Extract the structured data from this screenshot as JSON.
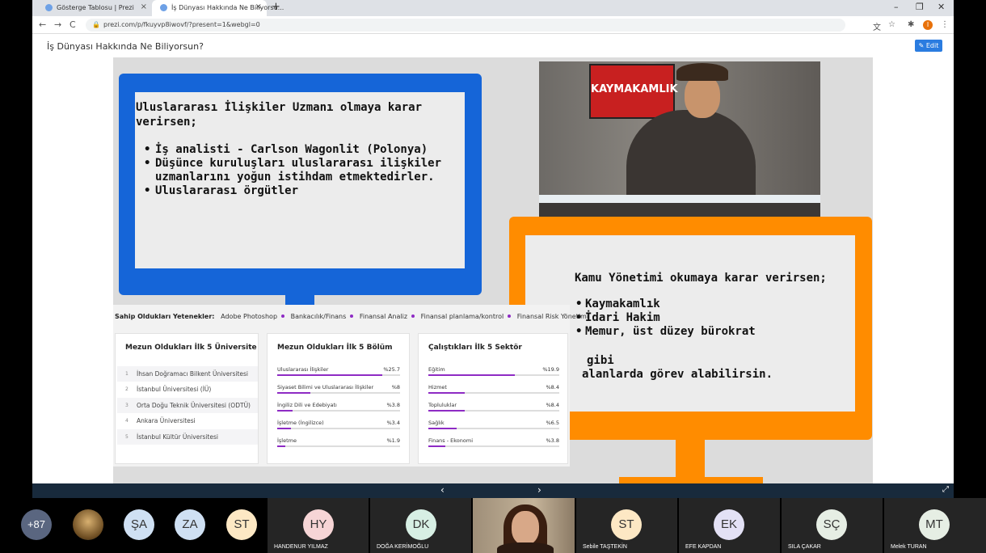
{
  "browser": {
    "tabs": [
      {
        "title": "Gösterge Tablosu | Prezi"
      },
      {
        "title": "İş Dünyası Hakkında Ne Biliyorsu..."
      }
    ],
    "new_tab": "+",
    "window_controls": {
      "minimize": "–",
      "restore": "❐",
      "close": "✕"
    },
    "nav": {
      "back": "←",
      "forward": "→",
      "reload": "C"
    },
    "url": "prezi.com/p/fkuyvp8iwovf/?present=1&webgl=0",
    "profile_initial": "I"
  },
  "prezi": {
    "title": "İş Dünyası Hakkında Ne Biliyorsun?",
    "edit_label": "Edit"
  },
  "slide": {
    "blue": {
      "heading": "Uluslararası İlişkiler Uzmanı olmaya karar verirsen;",
      "items": [
        "İş analisti - Carlson Wagonlit (Polonya)",
        "Düşünce kuruluşları uluslararası ilişkiler uzmanlarını yoğun istihdam etmektedirler.",
        "Uluslararası örgütler"
      ]
    },
    "photo_sign": "KAYMAKAMLIK",
    "orange": {
      "heading": "Kamu Yönetimi okumaya karar verirsen;",
      "items": [
        "Kaymakamlık",
        "İdari Hakim",
        "Memur, üst düzey bürokrat"
      ],
      "gibi": "gibi",
      "tail": "alanlarda görev alabilirsin."
    },
    "skills": {
      "label": "Sahip Oldukları Yetenekler:",
      "items": [
        "Adobe Photoshop",
        "Bankacılık/Finans",
        "Finansal Analiz",
        "Finansal planlama/kontrol",
        "Finansal Risk Yönetimi"
      ]
    },
    "universities": {
      "title": "Mezun Oldukları İlk 5 Üniversite",
      "items": [
        {
          "rank": "1",
          "name": "İhsan Doğramacı Bilkent Üniversitesi"
        },
        {
          "rank": "2",
          "name": "İstanbul Üniversitesi (İÜ)"
        },
        {
          "rank": "3",
          "name": "Orta Doğu Teknik Üniversitesi (ODTÜ)"
        },
        {
          "rank": "4",
          "name": "Ankara Üniversitesi"
        },
        {
          "rank": "5",
          "name": "İstanbul Kültür Üniversitesi"
        }
      ]
    },
    "departments": {
      "title": "Mezun Oldukları İlk 5 Bölüm",
      "items": [
        {
          "label": "Uluslararası İlişkiler",
          "pct": "%25.7",
          "value": 25.7
        },
        {
          "label": "Siyaset Bilimi ve Uluslararası İlişkiler",
          "pct": "%8",
          "value": 8
        },
        {
          "label": "İngiliz Dili ve Edebiyatı",
          "pct": "%3.8",
          "value": 3.8
        },
        {
          "label": "İşletme (İngilizce)",
          "pct": "%3.4",
          "value": 3.4
        },
        {
          "label": "İşletme",
          "pct": "%1.9",
          "value": 1.9
        }
      ]
    },
    "sectors": {
      "title": "Çalıştıkları İlk 5 Sektör",
      "items": [
        {
          "label": "Eğitim",
          "pct": "%19.9",
          "value": 19.9
        },
        {
          "label": "Hizmet",
          "pct": "%8.4",
          "value": 8.4
        },
        {
          "label": "Topluluklar",
          "pct": "%8.4",
          "value": 8.4
        },
        {
          "label": "Sağlık",
          "pct": "%6.5",
          "value": 6.5
        },
        {
          "label": "Finans - Ekonomi",
          "pct": "%3.8",
          "value": 3.8
        }
      ]
    }
  },
  "navbar": {
    "prev": "‹",
    "next": "›",
    "fullscreen": "⤢"
  },
  "participants": {
    "more": "+87",
    "tiles": [
      {
        "initials": "ŞA",
        "color": "#cfe0f3"
      },
      {
        "initials": "ZA",
        "color": "#cfe0f3"
      },
      {
        "initials": "ST",
        "color": "#fde8c4"
      },
      {
        "initials": "HY",
        "name": "HANDENUR YILMAZ",
        "color": "#f6d5d6"
      },
      {
        "initials": "DK",
        "name": "DOĞA KERİMOĞLU",
        "color": "#d7efe4"
      },
      {
        "initials": "ST",
        "name": "Sebile TAŞTEKİN",
        "color": "#fde8c4"
      },
      {
        "initials": "EK",
        "name": "EFE KAPDAN",
        "color": "#e3e1f5"
      },
      {
        "initials": "SÇ",
        "name": "SILA ÇAKAR",
        "color": "#e6eee4"
      },
      {
        "initials": "MT",
        "name": "Melek TURAN",
        "color": "#e6eee4"
      }
    ]
  }
}
